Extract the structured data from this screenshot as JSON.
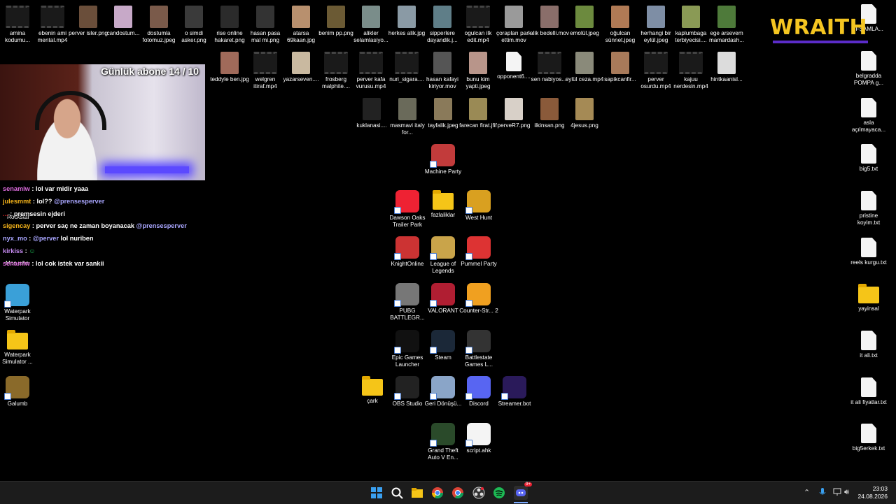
{
  "desktop": {
    "icons": [
      {
        "label": "amina kodumu...",
        "type": "video"
      },
      {
        "label": "ebenin ami mental.mp4",
        "type": "video"
      },
      {
        "label": "perver isler.png",
        "type": "image",
        "color": "#6a4e3a"
      },
      {
        "label": "candostum...",
        "type": "image",
        "color": "#c7a9c8"
      },
      {
        "label": "dostumla fotomuz.jpeg",
        "type": "image",
        "color": "#7a5a4a"
      },
      {
        "label": "o simdi asker.png",
        "type": "image",
        "color": "#3a3a3a"
      },
      {
        "label": "rise online hakaret.png",
        "type": "image",
        "color": "#2b2b2b"
      },
      {
        "label": "hasan pasa mal mi.png",
        "type": "image",
        "color": "#333"
      },
      {
        "label": "atarsa 69kaan.jpg",
        "type": "image",
        "color": "#b8906e"
      },
      {
        "label": "benim pp.png",
        "type": "image",
        "color": "#6b5a34"
      },
      {
        "label": "alikler selamlasiyo...",
        "type": "image",
        "color": "#7a8d8a"
      },
      {
        "label": "herkes alik.jpg",
        "type": "image",
        "color": "#8a9aa5"
      },
      {
        "label": "sipperlere dayandik.j...",
        "type": "image",
        "color": "#5f7e88"
      },
      {
        "label": "ogulcan ilk edit.mp4",
        "type": "video"
      },
      {
        "label": "çorapları park ettim.mov",
        "type": "image",
        "color": "#9a9a9a"
      },
      {
        "label": "alik bedelli.mov",
        "type": "image",
        "color": "#8a6e6a"
      },
      {
        "label": "emolül.jpeg",
        "type": "image",
        "color": "#6c8a3e"
      },
      {
        "label": "oğulcan sünnet.jpeg",
        "type": "image",
        "color": "#b07a55"
      },
      {
        "label": "herhangi bir eylül.jpeg",
        "type": "image",
        "color": "#7e8ea5"
      },
      {
        "label": "kaplumbaga terbiyecisi....",
        "type": "image",
        "color": "#8a9a55"
      },
      {
        "label": "ege arsevem mamardash...",
        "type": "image",
        "color": "#4e7a3a"
      },
      {
        "label": "teddyle ben.jpg",
        "type": "image",
        "color": "#a06a5a"
      },
      {
        "label": "welgren itiraf.mp4",
        "type": "video"
      },
      {
        "label": "yazarseven....",
        "type": "image",
        "color": "#c9b9a0"
      },
      {
        "label": "frosberg malphite....",
        "type": "video"
      },
      {
        "label": "perver kafa vurusu.mp4",
        "type": "video"
      },
      {
        "label": "nuri_sigara....",
        "type": "video"
      },
      {
        "label": "hasan kafayi kiriyor.mov",
        "type": "image",
        "color": "#555"
      },
      {
        "label": "bunu kim yapti.jpeg",
        "type": "image",
        "color": "#b8958a"
      },
      {
        "label": "opponent6....",
        "type": "doc"
      },
      {
        "label": "sen nabiyos....",
        "type": "video"
      },
      {
        "label": "eylül ceza.mp4",
        "type": "image",
        "color": "#8a8a7a"
      },
      {
        "label": "sapikcanfir...",
        "type": "image",
        "color": "#a87a5a"
      },
      {
        "label": "perver osurdu.mp4",
        "type": "video"
      },
      {
        "label": "kajuu nerdesin.mp4",
        "type": "video"
      },
      {
        "label": "hintkaanisl...",
        "type": "image",
        "color": "#dcdcdc"
      },
      {
        "label": "kuklanasi....",
        "type": "image",
        "color": "#222"
      },
      {
        "label": "masmavi italy for...",
        "type": "image",
        "color": "#6a6a5a"
      },
      {
        "label": "tayfalik.jpeg",
        "type": "image",
        "color": "#8a7a5a"
      },
      {
        "label": "farecan firat.jfif",
        "type": "image",
        "color": "#9a8a55"
      },
      {
        "label": "perveR7.png",
        "type": "image",
        "color": "#d8d0c8"
      },
      {
        "label": "ilkinsan.png",
        "type": "image",
        "color": "#8a5a3a"
      },
      {
        "label": "4jesus.png",
        "type": "image",
        "color": "#a58a55"
      },
      {
        "label": "Machine Party",
        "type": "app",
        "color": "#c23b3b"
      },
      {
        "label": "Dawson Oaks Trailer Park",
        "type": "app",
        "color": "#e23"
      },
      {
        "label": "fazlaliklar",
        "type": "folder"
      },
      {
        "label": "West Hunt",
        "type": "app",
        "color": "#d9a020"
      },
      {
        "label": "KnightOnline",
        "type": "app",
        "color": "#c33"
      },
      {
        "label": "League of Legends",
        "type": "app",
        "color": "#c9a44a"
      },
      {
        "label": "Pummel Party",
        "type": "app",
        "color": "#d33"
      },
      {
        "label": "PUBG BATTLEGR...",
        "type": "app",
        "color": "#777"
      },
      {
        "label": "VALORANT",
        "type": "app",
        "color": "#b01e32"
      },
      {
        "label": "Counter-Str... 2",
        "type": "app",
        "color": "#f0a020"
      },
      {
        "label": "Epic Games Launcher",
        "type": "app",
        "color": "#111"
      },
      {
        "label": "Steam",
        "type": "app",
        "color": "#1b2838"
      },
      {
        "label": "Battlestate Games L...",
        "type": "app",
        "color": "#333"
      },
      {
        "label": "çark",
        "type": "folder"
      },
      {
        "label": "OBS Studio",
        "type": "app",
        "color": "#222"
      },
      {
        "label": "Geri Dönüşü...",
        "type": "app",
        "color": "#8aa5c8"
      },
      {
        "label": "Discord",
        "type": "app",
        "color": "#5865f2"
      },
      {
        "label": "Streamer.bot",
        "type": "app",
        "color": "#2a1a5a"
      },
      {
        "label": "Grand Theft Auto V En...",
        "type": "app",
        "color": "#2a4a2a"
      },
      {
        "label": "script.ahk",
        "type": "app",
        "color": "#f4f4f4"
      },
      {
        "label": "Waterpark Simulator",
        "type": "app",
        "color": "#3aa0d8"
      },
      {
        "label": "Waterpark Simulator ...",
        "type": "folder"
      },
      {
        "label": "Galumb",
        "type": "app",
        "color": "#8a6a2a"
      },
      {
        "label": "İFŞAMLA...",
        "type": "doc"
      },
      {
        "label": "belgradda POMPA g...",
        "type": "doc"
      },
      {
        "label": "asla açılmayaca...",
        "type": "doc"
      },
      {
        "label": "big5.txt",
        "type": "doc"
      },
      {
        "label": "pristine koyim.txt",
        "type": "doc"
      },
      {
        "label": "reels kurgu.txt",
        "type": "doc"
      },
      {
        "label": "yayinsal",
        "type": "folder"
      },
      {
        "label": "it ali.txt",
        "type": "doc"
      },
      {
        "label": "it ali fiyatlar.txt",
        "type": "doc"
      },
      {
        "label": "big5erkek.txt",
        "type": "doc"
      }
    ]
  },
  "overlay": {
    "sub_goal": "Günlük abone 14 / 10",
    "brand": "WRAITH",
    "hidden_labels": [
      "Rockstar",
      "Moo who"
    ]
  },
  "chat": [
    {
      "user": "senamiw",
      "user_color": "#d96ad9",
      "text": "lol var midir yaaa",
      "mention": ""
    },
    {
      "user": "julesmmt",
      "user_color": "#f5b41a",
      "text": "lol??",
      "mention": "@prensesperver"
    },
    {
      "user": "...",
      "user_color": "#c22",
      "text": "premsesin ejderi",
      "mention": ""
    },
    {
      "user": "sigencay",
      "user_color": "#f5b41a",
      "text": "perver saç ne zaman boyanacak",
      "mention": "@prensesperver"
    },
    {
      "user": "nyx_mo",
      "user_color": "#a9a6ff",
      "text": "lol nuriben",
      "mention": "@perver"
    },
    {
      "user": "kirkiss",
      "user_color": "#c58af0",
      "text": "☺",
      "mention": ""
    },
    {
      "user": "senamiw",
      "user_color": "#d96ad9",
      "text": "lol cok istek var sankii",
      "mention": ""
    }
  ],
  "taskbar": {
    "apps": [
      "start-icon",
      "search-icon",
      "file-explorer-icon",
      "chrome-icon",
      "chrome-alt-icon",
      "obs-icon",
      "spotify-icon",
      "discord-icon"
    ],
    "discord_badge": "9+",
    "time": "23:03",
    "date": "24.08.2026"
  },
  "colors": {
    "brand_yellow": "#f4c521",
    "brand_purple": "#5b2cc9",
    "taskbar": "#1c1c1c"
  }
}
